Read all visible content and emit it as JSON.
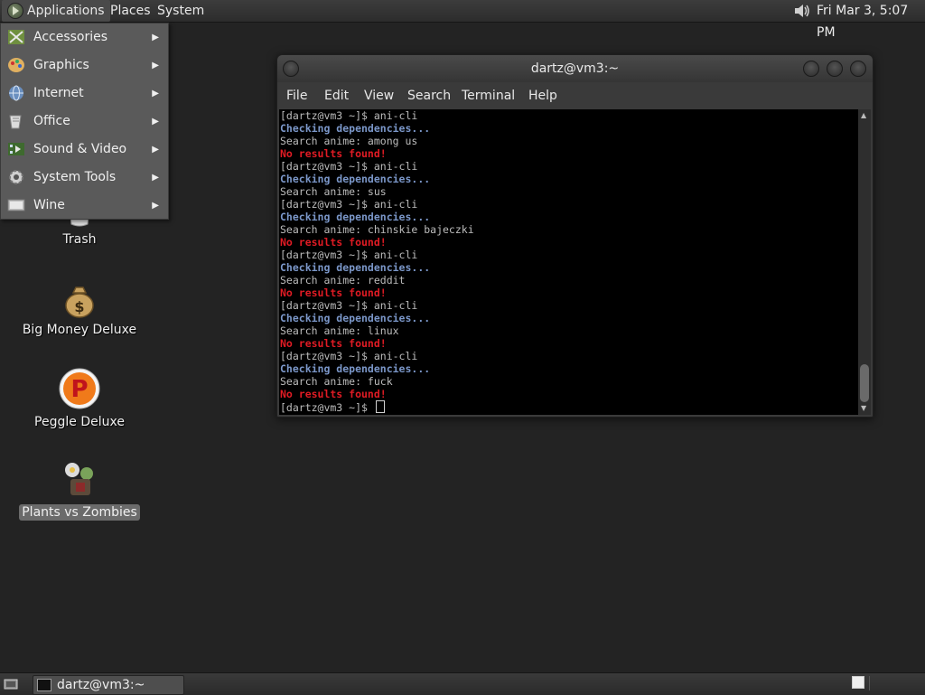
{
  "top_panel": {
    "applications": "Applications",
    "places": "Places",
    "system": "System",
    "clock": "Fri Mar  3,  5:07 PM",
    "volume_icon": "speaker-icon"
  },
  "app_menu": {
    "items": [
      {
        "label": "Accessories",
        "icon": "accessories-icon"
      },
      {
        "label": "Graphics",
        "icon": "graphics-icon"
      },
      {
        "label": "Internet",
        "icon": "globe-icon"
      },
      {
        "label": "Office",
        "icon": "office-icon"
      },
      {
        "label": "Sound & Video",
        "icon": "multimedia-icon"
      },
      {
        "label": "System Tools",
        "icon": "gear-icon"
      },
      {
        "label": "Wine",
        "icon": "wine-icon"
      }
    ]
  },
  "desktop": {
    "icons": [
      {
        "label": "Trash"
      },
      {
        "label": "Big Money Deluxe"
      },
      {
        "label": "Peggle Deluxe"
      },
      {
        "label": "Plants vs Zombies"
      }
    ]
  },
  "terminal": {
    "title": "dartz@vm3:~",
    "menu": [
      "File",
      "Edit",
      "View",
      "Search",
      "Terminal",
      "Help"
    ],
    "lines": [
      {
        "text": "[dartz@vm3 ~]$ ani-cli",
        "style": "plain"
      },
      {
        "text": "Checking dependencies...",
        "style": "blue"
      },
      {
        "text": "Search anime: among us",
        "style": "plain"
      },
      {
        "text": "No results found!",
        "style": "red"
      },
      {
        "text": "[dartz@vm3 ~]$ ani-cli",
        "style": "plain"
      },
      {
        "text": "Checking dependencies...",
        "style": "blue"
      },
      {
        "text": "Search anime: sus",
        "style": "plain"
      },
      {
        "text": "[dartz@vm3 ~]$ ani-cli",
        "style": "plain"
      },
      {
        "text": "Checking dependencies...",
        "style": "blue"
      },
      {
        "text": "Search anime: chinskie bajeczki",
        "style": "plain"
      },
      {
        "text": "No results found!",
        "style": "red"
      },
      {
        "text": "[dartz@vm3 ~]$ ani-cli",
        "style": "plain"
      },
      {
        "text": "Checking dependencies...",
        "style": "blue"
      },
      {
        "text": "Search anime: reddit",
        "style": "plain"
      },
      {
        "text": "No results found!",
        "style": "red"
      },
      {
        "text": "[dartz@vm3 ~]$ ani-cli",
        "style": "plain"
      },
      {
        "text": "Checking dependencies...",
        "style": "blue"
      },
      {
        "text": "Search anime: linux",
        "style": "plain"
      },
      {
        "text": "No results found!",
        "style": "red"
      },
      {
        "text": "[dartz@vm3 ~]$ ani-cli",
        "style": "plain"
      },
      {
        "text": "Checking dependencies...",
        "style": "blue"
      },
      {
        "text": "Search anime: fuck",
        "style": "plain"
      },
      {
        "text": "No results found!",
        "style": "red"
      }
    ],
    "prompt": "[dartz@vm3 ~]$ "
  },
  "taskbar": {
    "task_label": "dartz@vm3:~"
  },
  "colors": {
    "desktop_bg": "#232323",
    "term_blue": "#7b97c9",
    "term_red": "#e01b24"
  }
}
